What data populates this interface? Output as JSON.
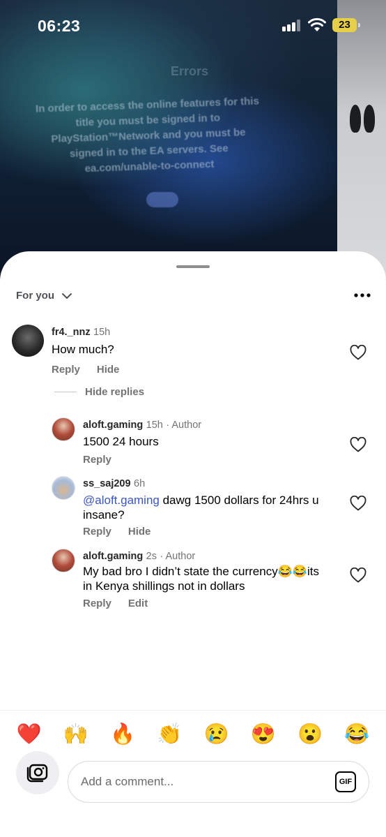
{
  "status_bar": {
    "time": "06:23",
    "battery": "23"
  },
  "background": {
    "tv_heading": "Errors",
    "tv_message": "In order to access the online features for this title you must be signed in to PlayStation™Network and you must be signed in to the EA servers. See ea.com/unable-to-connect"
  },
  "header": {
    "sort_label": "For you"
  },
  "comments": [
    {
      "username": "fr4._nnz",
      "time": "15h",
      "author": "",
      "text": "How much?",
      "reply": "Reply",
      "hide": "Hide"
    },
    {
      "username": "aloft.gaming",
      "time": "15h",
      "author": "Author",
      "text": "1500 24 hours",
      "reply": "Reply"
    },
    {
      "username": "ss_saj209",
      "time": "6h",
      "author": "",
      "mention": "@aloft.gaming",
      "text": " dawg 1500 dollars for 24hrs u insane?",
      "reply": "Reply",
      "hide": "Hide"
    },
    {
      "username": "aloft.gaming",
      "time": "2s",
      "author": "Author",
      "text": "My bad bro I didn’t state the currency😂😂its in Kenya shillings not in dollars",
      "reply": "Reply",
      "edit": "Edit"
    }
  ],
  "hide_replies": "Hide replies",
  "quick_reactions": [
    "❤️",
    "🙌",
    "🔥",
    "👏",
    "😢",
    "😍",
    "😮",
    "😂"
  ],
  "composer": {
    "placeholder": "Add a comment...",
    "gif_label": "GIF"
  },
  "colors": {
    "mention": "#3b56c4",
    "secondary_text": "#737373",
    "battery": "#e6d04a"
  }
}
